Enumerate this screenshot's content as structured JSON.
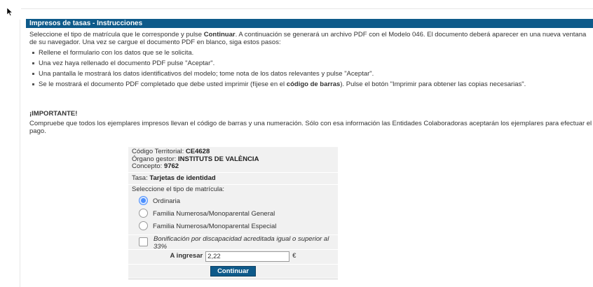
{
  "header": {
    "title": "Impresos de tasas - Instrucciones"
  },
  "intro": {
    "pre": "Seleccione el tipo de matrícula que le corresponde y pulse ",
    "bold": "Continuar",
    "post": ". A continuación se generará un archivo PDF con el Modelo 046. El documento deberá aparecer en una nueva ventana de su navegador. Una vez se cargue el documento PDF en blanco, siga estos pasos:"
  },
  "steps": [
    "Rellene el formulario con los datos que se le solicita.",
    "Una vez haya rellenado el documento PDF pulse \"Aceptar\".",
    "Una pantalla le mostrará los datos identificativos del modelo; tome nota de los datos relevantes y pulse \"Aceptar\"."
  ],
  "step4": {
    "pre": "Se le mostrará el documento PDF completado que debe usted imprimir (fíjese en el ",
    "bold": "código de barras",
    "post": "). Pulse el botón \"Imprimir para obtener las copias necesarias\"."
  },
  "important": {
    "title": "¡IMPORTANTE!",
    "text": "Compruebe que todos los ejemplares impresos llevan el código de barras y una numeración. Sólo con esa información las Entidades Colaboradoras aceptarán los ejemplares para efectuar el pago."
  },
  "panel": {
    "codigo_label": "Código Territorial: ",
    "codigo_value": "CE4628",
    "organo_label": "Órgano gestor: ",
    "organo_value": "INSTITUTS DE VALÈNCIA",
    "concepto_label": "Concepto: ",
    "concepto_value": "9762",
    "tasa_label": "Tasa: ",
    "tasa_value": "Tarjetas de identidad",
    "select_label": "Seleccione el tipo de matrícula:",
    "options": [
      "Ordinaria",
      "Familia Numerosa/Monoparental General",
      "Familia Numerosa/Monoparental Especial"
    ],
    "selected_index": 0,
    "bonificacion": "Bonificación por discapacidad acreditada igual o superior al 33%",
    "ingresar_label": "A ingresar",
    "ingresar_value": "2,22",
    "currency": "€",
    "continue_button": "Continuar"
  },
  "colors": {
    "header_bg": "#0e5a8a",
    "panel_bg": "#f1f1f1",
    "radio_selected": "#4d90fe"
  }
}
